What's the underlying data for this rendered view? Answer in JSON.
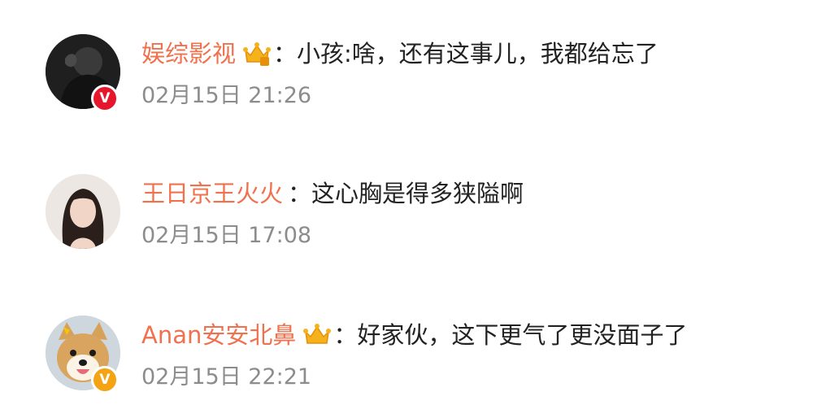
{
  "comments": [
    {
      "username": "娱综影视",
      "separator": "：",
      "text": "小孩:啥，还有这事儿，我都给忘了",
      "time": "02月15日 21:26",
      "verified_badge": "V",
      "badge_color": "#e6162d",
      "has_crown": true,
      "avatar_icon": "dark-portrait-avatar"
    },
    {
      "username": "王日京王火火",
      "separator": "：",
      "text": "这心胸是得多狭隘啊",
      "time": "02月15日 17:08",
      "verified_badge": "",
      "badge_color": "",
      "has_crown": false,
      "avatar_icon": "woman-portrait-avatar"
    },
    {
      "username": "Anan安安北鼻",
      "separator": "：",
      "text": "好家伙，这下更气了更没面子了",
      "time": "02月15日 22:21",
      "verified_badge": "V",
      "badge_color": "#f4a312",
      "has_crown": true,
      "avatar_icon": "shiba-dog-avatar"
    }
  ],
  "colors": {
    "username": "#f0714e",
    "text": "#222222",
    "time": "#8c8c8c",
    "crown": "#f6b21b"
  }
}
